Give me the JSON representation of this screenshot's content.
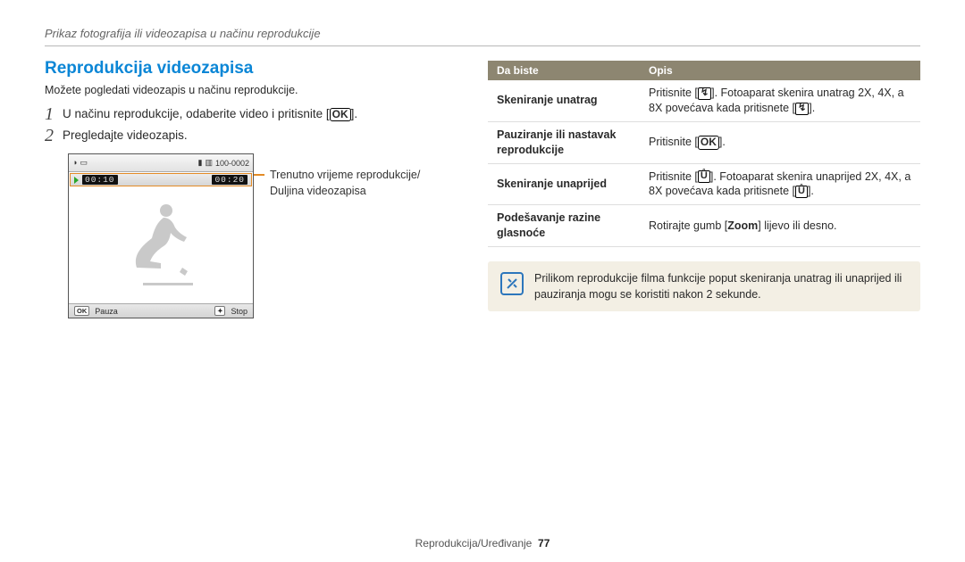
{
  "breadcrumb": "Prikaz fotografija ili videozapisa u načinu reprodukcije",
  "section_title": "Reprodukcija videozapisa",
  "intro": "Možete pogledati videozapis u načinu reprodukcije.",
  "steps": {
    "n1": "1",
    "s1_pre": "U načinu reprodukcije, odaberite video i pritisnite [",
    "s1_ok": "OK",
    "s1_post": "].",
    "n2": "2",
    "s2": "Pregledajte videozapis."
  },
  "player": {
    "top_status": "100-0002",
    "elapsed": "00:10",
    "total": "00:20",
    "ok_label": "OK",
    "pause_label": "Pauza",
    "trash_sym": "✦",
    "stop_label": "Stop"
  },
  "callout": {
    "l1": "Trenutno vrijeme reprodukcije/",
    "l2": "Duljina videozapisa"
  },
  "table": {
    "h1": "Da biste",
    "h2": "Opis",
    "r1k": "Skeniranje unatrag",
    "r1a": "Pritisnite [",
    "r1g": "↯",
    "r1b": "]. Fotoaparat skenira unatrag 2X, 4X, a 8X povećava kada pritisnete [",
    "r1c": "].",
    "r2k": "Pauziranje ili nastavak reprodukcije",
    "r2a": "Pritisnite [",
    "r2g": "OK",
    "r2b": "].",
    "r3k": "Skeniranje unaprijed",
    "r3a": "Pritisnite [",
    "r3g": "Ů",
    "r3b": "]. Fotoaparat skenira unaprijed 2X, 4X, a 8X povećava kada pritisnete [",
    "r3c": "].",
    "r4k": "Podešavanje razine glasnoće",
    "r4a": "Rotirajte gumb [",
    "r4b": "Zoom",
    "r4c": "] lijevo ili desno."
  },
  "note": "Prilikom reprodukcije filma funkcije poput skeniranja unatrag ili unaprijed ili pauziranja mogu se koristiti nakon 2 sekunde.",
  "footer": {
    "section": "Reprodukcija/Uređivanje",
    "page": "77"
  }
}
